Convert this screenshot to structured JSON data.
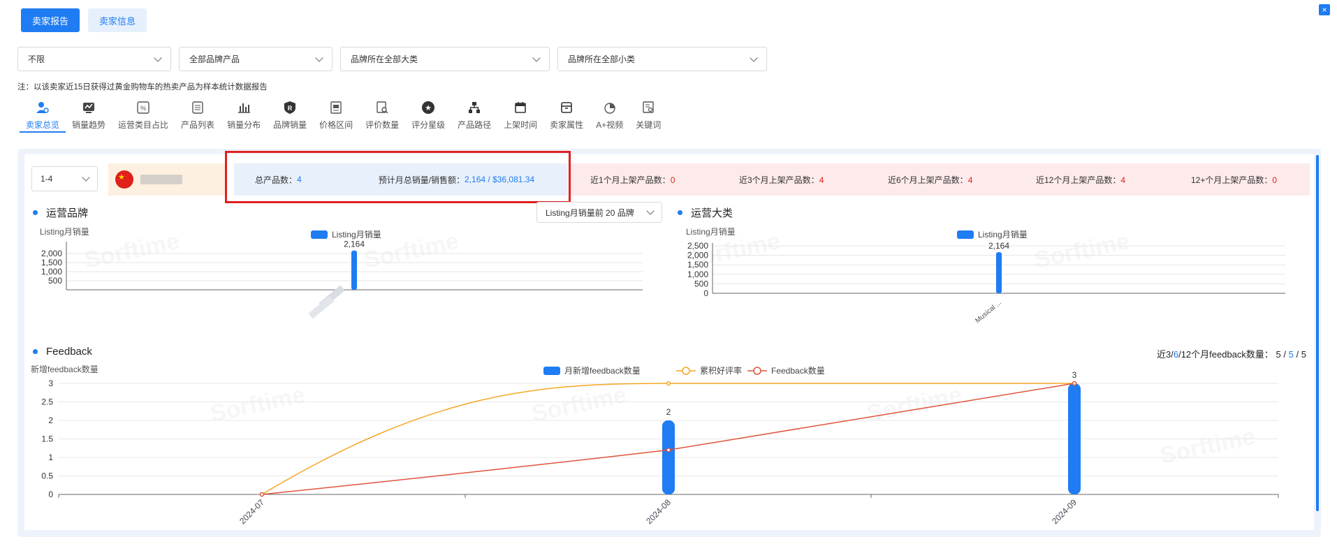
{
  "top_buttons": {
    "seller_report": "卖家报告",
    "seller_info": "卖家信息"
  },
  "close_label": "×",
  "filters": [
    {
      "value": "不限"
    },
    {
      "value": "全部品牌产品"
    },
    {
      "value": "品牌所在全部大类"
    },
    {
      "value": "品牌所在全部小类"
    }
  ],
  "note": "注：以该卖家近15日获得过黄金购物车的热卖产品为样本统计数据报告",
  "tabs": [
    {
      "label": "卖家总览",
      "icon": "user-icon",
      "active": true
    },
    {
      "label": "销量趋势",
      "icon": "trend-icon"
    },
    {
      "label": "运营类目占比",
      "icon": "percent-icon"
    },
    {
      "label": "产品列表",
      "icon": "list-icon"
    },
    {
      "label": "销量分布",
      "icon": "bar-chart-icon"
    },
    {
      "label": "品牌销量",
      "icon": "brand-r-icon"
    },
    {
      "label": "价格区间",
      "icon": "price-icon"
    },
    {
      "label": "评价数量",
      "icon": "review-search-icon"
    },
    {
      "label": "评分星级",
      "icon": "star-icon"
    },
    {
      "label": "产品路径",
      "icon": "tree-icon"
    },
    {
      "label": "上架时间",
      "icon": "calendar-icon"
    },
    {
      "label": "卖家属性",
      "icon": "box-icon"
    },
    {
      "label": "A+视频",
      "icon": "pie-icon"
    },
    {
      "label": "关键词",
      "icon": "keyword-icon"
    }
  ],
  "stats": {
    "range": "1-4",
    "total_products_label": "总产品数：",
    "total_products": "4",
    "monthly_label": "预计月总销量/销售额：",
    "monthly_value": "2,164 / $36,081.34",
    "recent": [
      {
        "label": "近1个月上架产品数：",
        "value": "0"
      },
      {
        "label": "近3个月上架产品数：",
        "value": "4"
      },
      {
        "label": "近6个月上架产品数：",
        "value": "4"
      },
      {
        "label": "近12个月上架产品数：",
        "value": "4"
      },
      {
        "label": "12+个月上架产品数：",
        "value": "0"
      }
    ]
  },
  "brand_section": {
    "title": "运营品牌",
    "select": "Listing月销量前 20 品牌"
  },
  "category_section": {
    "title": "运营大类"
  },
  "feedback_section": {
    "title": "Feedback",
    "count_label": "近3/6/12个月feedback数量：",
    "count_3": "5",
    "count_6": "5",
    "count_12": "5",
    "sep": "/",
    "label_prefix_1": "近3",
    "label_prefix_2": "6",
    "label_prefix_3": "12个月feedback数量：",
    "label_slash": "/"
  },
  "watermark_text": "Sorftime",
  "chart_data": [
    {
      "type": "bar",
      "ylabel": "Listing月销量",
      "legend": [
        "Listing月销量"
      ],
      "categories": [
        ""
      ],
      "values": [
        2164
      ],
      "data_labels": [
        "2,164"
      ],
      "yticks": [
        "500",
        "1,000",
        "1,500",
        "2,000"
      ],
      "ylim": [
        0,
        2500
      ],
      "colors": {
        "bar": "#1f7cf3"
      }
    },
    {
      "type": "bar",
      "ylabel": "Listing月销量",
      "legend": [
        "Listing月销量"
      ],
      "categories": [
        "Musical ..."
      ],
      "values": [
        2164
      ],
      "data_labels": [
        "2,164"
      ],
      "yticks": [
        "0",
        "500",
        "1,000",
        "1,500",
        "2,000",
        "2,500"
      ],
      "ylim": [
        0,
        2500
      ],
      "colors": {
        "bar": "#1f7cf3"
      }
    },
    {
      "type": "bar",
      "ylabel": "新增feedback数量",
      "legend": [
        "月新增feedback数量",
        "累积好评率",
        "Feedback数量"
      ],
      "categories": [
        "2024-07",
        "2024-08",
        "2024-09"
      ],
      "series": [
        {
          "name": "月新增feedback数量",
          "type": "bar",
          "values": [
            0,
            2,
            3
          ],
          "color": "#1f7cf3"
        },
        {
          "name": "累积好评率",
          "type": "line",
          "values": [
            0,
            3,
            3
          ],
          "color": "#f5a623"
        },
        {
          "name": "Feedback数量",
          "type": "line",
          "values": [
            0,
            1.2,
            3
          ],
          "color": "#e0533c"
        }
      ],
      "data_labels": [
        "2",
        "3"
      ],
      "yticks": [
        "0",
        "0.5",
        "1",
        "1.5",
        "2",
        "2.5",
        "3"
      ],
      "ylim": [
        0,
        3
      ]
    }
  ]
}
